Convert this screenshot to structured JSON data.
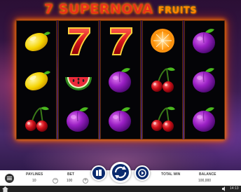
{
  "game": {
    "title_prefix": "7 SUPERN",
    "title_o": "O",
    "title_suffix": "VA",
    "title_fruits": "FRUITS"
  },
  "reels": [
    [
      "lemon",
      "lemon",
      "cherry"
    ],
    [
      "seven",
      "watermelon",
      "plum"
    ],
    [
      "seven",
      "plum",
      "plum"
    ],
    [
      "orange",
      "cherry",
      "cherry"
    ],
    [
      "plum",
      "plum",
      "plum"
    ]
  ],
  "symbol_icons": {
    "lemon": "lemon-icon",
    "cherry": "cherry-icon",
    "seven": "seven-icon",
    "watermelon": "watermelon-icon",
    "plum": "plum-icon",
    "orange": "orange-icon"
  },
  "controls": {
    "paylines_label": "PAYLINES",
    "paylines_value": "10",
    "bet_label": "BET",
    "bet_value": "100",
    "bet_minus": "−",
    "bet_plus": "+",
    "total_win_label": "TOTAL WIN",
    "balance_label": "BALANCE",
    "balance_value": "100,000"
  },
  "footer": {
    "time": "14:13"
  },
  "colors": {
    "reel_glow": "#ff7a00",
    "control_blue": "#0a2a6e",
    "title_red": "#e8321e"
  }
}
